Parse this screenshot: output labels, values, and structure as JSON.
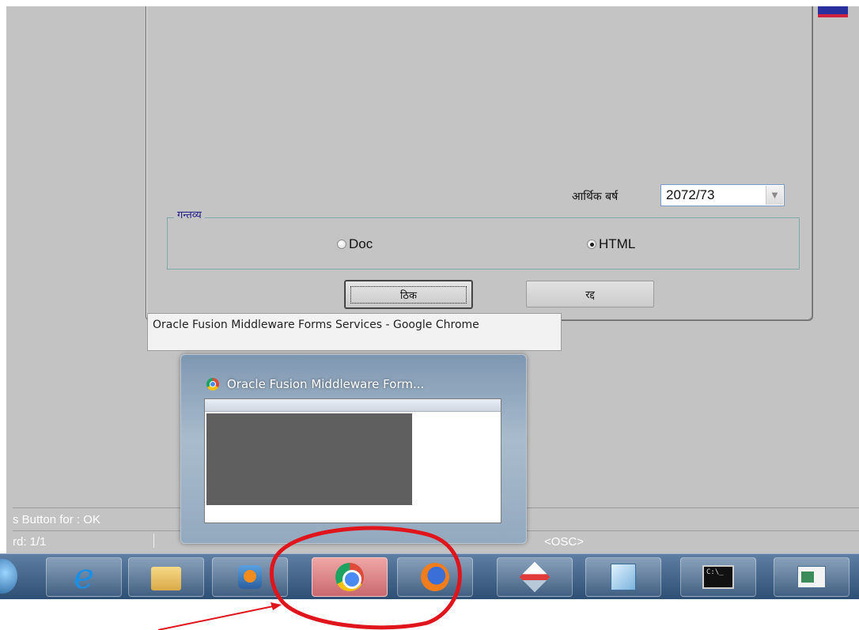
{
  "form": {
    "year_label": "आर्थिक बर्ष",
    "year_value": "2072/73",
    "destination_legend": "गन्तव्य",
    "radio_doc_label": "Doc",
    "radio_html_label": "HTML",
    "ok_label": "ठिक",
    "cancel_label": "रद्द"
  },
  "tooltip": {
    "text": "Oracle Fusion Middleware Forms Services - Google Chrome"
  },
  "status": {
    "line1": "s Button for : OK",
    "line2": "rd: 1/1",
    "mode": "<OSC>"
  },
  "thumbnail": {
    "title": "Oracle Fusion Middleware Form..."
  },
  "taskbar": {
    "items": [
      {
        "icon": "internet-explorer-icon"
      },
      {
        "icon": "windows-explorer-icon"
      },
      {
        "icon": "media-player-icon"
      },
      {
        "icon": "chrome-icon",
        "active": true
      },
      {
        "icon": "firefox-icon"
      },
      {
        "icon": "tool-icon"
      },
      {
        "icon": "notepad-icon"
      },
      {
        "icon": "command-prompt-icon"
      },
      {
        "icon": "window-icon"
      }
    ]
  },
  "colors": {
    "form_bg": "#c4c4c4",
    "legend_text": "#1d1a86",
    "annotation_red": "#e0141b",
    "taskbar_active": "#c9696f"
  }
}
